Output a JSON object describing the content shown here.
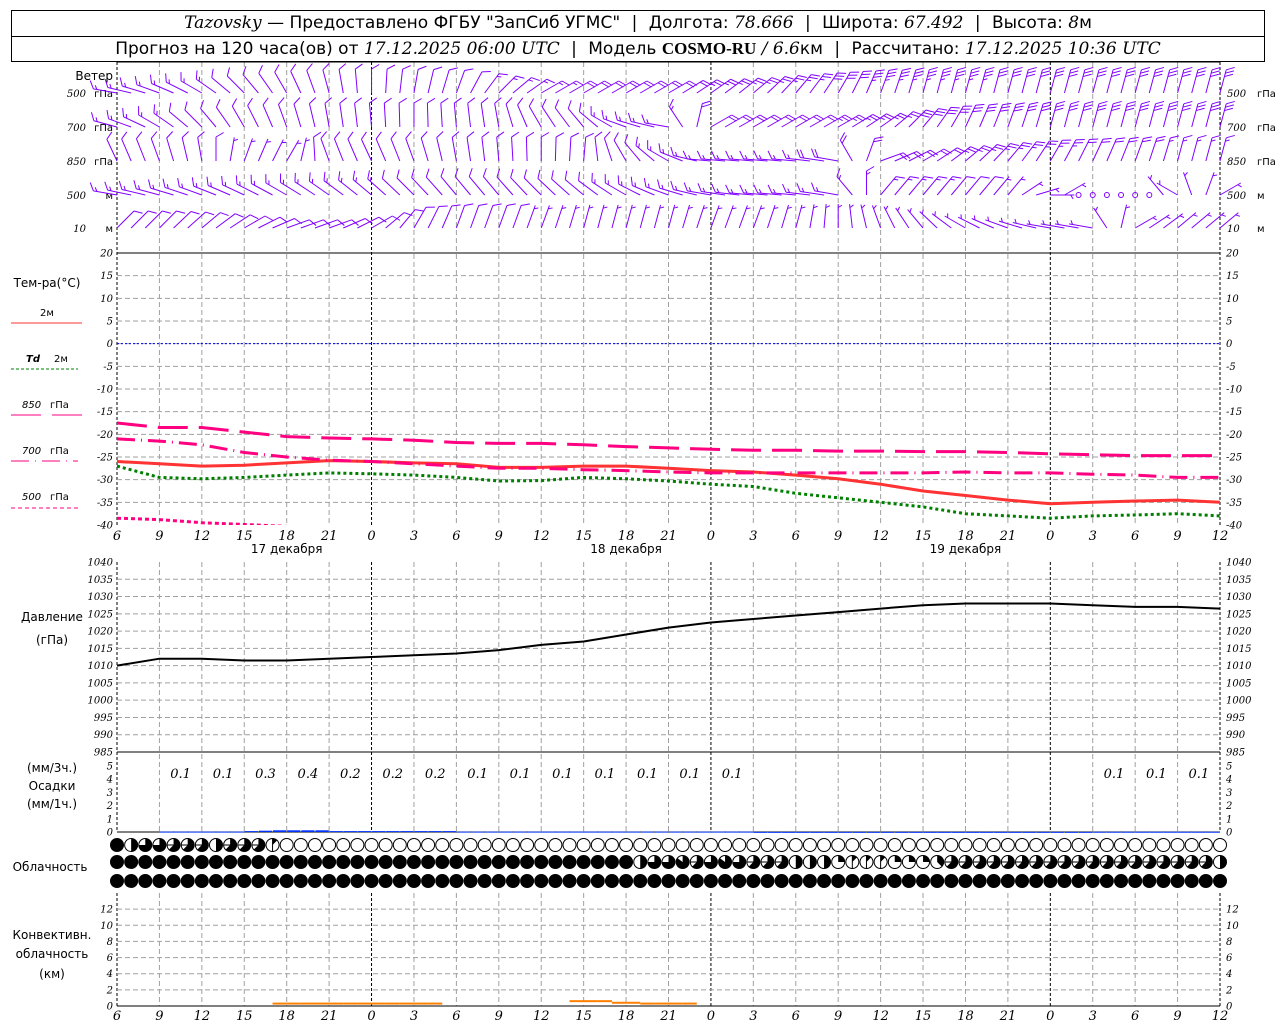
{
  "header": {
    "station": "Tazovsky",
    "provider": "— Предоставлено ФГБУ \"ЗапСиб УГМС\"",
    "lon_label": "Долгота:",
    "lon": "78.666",
    "lat_label": "Широта:",
    "lat": "67.492",
    "alt_label": "Высота:",
    "alt": "8",
    "alt_unit": "м",
    "forecast_label": "Прогноз на 120 часа(ов) от",
    "forecast_start": "17.12.2025 06:00 UTC",
    "model_label": "Модель",
    "model": "COSMO-RU",
    "resolution": "/ 6.6",
    "resolution_unit": "км",
    "computed_label": "Рассчитано:",
    "computed": "17.12.2025 10:36 UTC"
  },
  "colors": {
    "wind": "#8000ff",
    "t2m": "#ff3333",
    "td2m": "#008000",
    "t850": "#ff0080",
    "t700": "#ff0080",
    "t500": "#ff0080",
    "zero_line": "#0000ff",
    "pressure": "#000000",
    "precip": "#0033ff",
    "convective": "#ff8000",
    "grid": "#a0a0a0"
  },
  "labels": {
    "wind": "Ветер",
    "temp": "Тем-ра(°C)",
    "t2m": "2м",
    "td_symbol": "Td",
    "td_level": "2м",
    "l850": "850",
    "l700": "700",
    "l500": "500",
    "gpa": "гПа",
    "pressure": "Давление",
    "pressure_unit": "(гПа)",
    "precip_3h": "(мм/3ч.)",
    "precip": "Осадки",
    "precip_1h": "(мм/1ч.)",
    "clouds": "Облачность",
    "conv1": "Конвективн.",
    "conv2": "облачность",
    "conv3": "(км)"
  },
  "chart_data": {
    "type": "line",
    "time_ticks": [
      "6",
      "9",
      "12",
      "15",
      "18",
      "21",
      "0",
      "3",
      "6",
      "9",
      "12",
      "15",
      "18",
      "21",
      "0",
      "3",
      "6",
      "9",
      "12",
      "15",
      "18",
      "21",
      "0",
      "3",
      "6",
      "9",
      "12"
    ],
    "day_labels": [
      "17 декабря",
      "18 декабря",
      "19 декабря"
    ],
    "wind": {
      "levels": [
        {
          "label": "500",
          "unit": "гПа",
          "dir": [
            280,
            290,
            300,
            315,
            330,
            345,
            0,
            10,
            20,
            45,
            60,
            60,
            60,
            60,
            55,
            50,
            40,
            30,
            20,
            15,
            15,
            15,
            15,
            15,
            15,
            15,
            15
          ],
          "speed_kt": [
            15,
            15,
            15,
            10,
            10,
            10,
            10,
            10,
            10,
            15,
            15,
            20,
            20,
            20,
            25,
            25,
            25,
            30,
            35,
            35,
            35,
            30,
            30,
            30,
            30,
            30,
            30
          ]
        },
        {
          "label": "700",
          "unit": "гПа",
          "dir": [
            285,
            300,
            315,
            330,
            340,
            350,
            355,
            0,
            355,
            350,
            330,
            320,
            290,
            280,
            60,
            60,
            60,
            60,
            55,
            40,
            25,
            20,
            15,
            15,
            15,
            15,
            15
          ],
          "speed_kt": [
            15,
            15,
            10,
            10,
            10,
            10,
            10,
            10,
            10,
            10,
            10,
            10,
            15,
            15,
            20,
            20,
            20,
            25,
            25,
            30,
            30,
            30,
            30,
            30,
            30,
            30,
            30
          ]
        },
        {
          "label": "850",
          "unit": "гПа",
          "dir": [
            335,
            340,
            350,
            20,
            30,
            340,
            335,
            340,
            350,
            355,
            0,
            5,
            330,
            300,
            275,
            275,
            275,
            280,
            70,
            60,
            50,
            40,
            30,
            25,
            20,
            15,
            15
          ],
          "speed_kt": [
            10,
            10,
            10,
            5,
            5,
            10,
            10,
            10,
            10,
            10,
            10,
            10,
            10,
            15,
            15,
            15,
            15,
            20,
            20,
            20,
            25,
            25,
            25,
            20,
            20,
            15,
            15
          ]
        },
        {
          "label": "500",
          "unit": "м",
          "dir": [
            280,
            285,
            290,
            295,
            300,
            305,
            310,
            315,
            320,
            320,
            315,
            310,
            300,
            290,
            280,
            275,
            275,
            280,
            40,
            40,
            40,
            40,
            90,
            0,
            0,
            300,
            60
          ],
          "speed_kt": [
            15,
            15,
            15,
            15,
            15,
            15,
            15,
            10,
            10,
            10,
            10,
            10,
            15,
            15,
            15,
            15,
            15,
            15,
            15,
            15,
            10,
            5,
            5,
            0,
            0,
            5,
            5
          ]
        },
        {
          "label": "10",
          "unit": "м",
          "dir": [
            45,
            45,
            50,
            60,
            70,
            70,
            60,
            30,
            20,
            20,
            20,
            15,
            15,
            15,
            20,
            20,
            15,
            0,
            340,
            320,
            300,
            290,
            280,
            280,
            60,
            50,
            50
          ],
          "speed_kt": [
            10,
            10,
            10,
            10,
            10,
            10,
            10,
            10,
            10,
            10,
            5,
            5,
            5,
            5,
            5,
            5,
            5,
            5,
            5,
            5,
            5,
            5,
            5,
            5,
            5,
            5,
            5
          ]
        }
      ]
    },
    "temperature": {
      "ylim": [
        -40,
        20
      ],
      "yticks": [
        20,
        15,
        10,
        5,
        0,
        -5,
        -10,
        -15,
        -20,
        -25,
        -30,
        -35,
        -40
      ],
      "series": [
        {
          "name": "2м",
          "style": "solid",
          "values": [
            -26,
            -26.5,
            -27,
            -26.8,
            -26.3,
            -25.8,
            -26,
            -26.3,
            -26.5,
            -27.3,
            -27.3,
            -27,
            -27,
            -27.5,
            -28,
            -28.3,
            -29,
            -29.8,
            -31,
            -32.5,
            -33.5,
            -34.5,
            -35.3,
            -35,
            -34.7,
            -34.5,
            -35
          ]
        },
        {
          "name": "Td 2м",
          "style": "dotted",
          "values": [
            -27,
            -29.5,
            -29.8,
            -29.5,
            -29,
            -28.5,
            -28.7,
            -29,
            -29.5,
            -30.3,
            -30.2,
            -29.5,
            -29.8,
            -30.3,
            -31,
            -31.5,
            -33,
            -34,
            -35,
            -36,
            -37.5,
            -38,
            -38.5,
            -38,
            -37.8,
            -37.5,
            -38
          ]
        },
        {
          "name": "850 гПа",
          "style": "dash",
          "values": [
            -17.5,
            -18.5,
            -18.5,
            -19.5,
            -20.5,
            -20.8,
            -21,
            -21.3,
            -21.8,
            -22,
            -22,
            -22.3,
            -22.7,
            -23,
            -23.3,
            -23.5,
            -23.5,
            -23.7,
            -23.7,
            -23.8,
            -23.8,
            -24,
            -24.3,
            -24.5,
            -24.7,
            -24.7,
            -24.7
          ]
        },
        {
          "name": "700 гПа",
          "style": "dashdot",
          "values": [
            -21,
            -21.5,
            -22.3,
            -24,
            -25,
            -25.7,
            -26,
            -26.5,
            -27,
            -27.5,
            -27.5,
            -27.8,
            -28,
            -28.3,
            -28.5,
            -28.5,
            -28.5,
            -28.5,
            -28.5,
            -28.5,
            -28.3,
            -28.5,
            -28.5,
            -28.8,
            -29,
            -29.5,
            -29.5
          ]
        },
        {
          "name": "500 гПа",
          "style": "shortdash",
          "values": [
            -38.5,
            -38.8,
            -39.5,
            -39.9,
            -40.3,
            null,
            null,
            null,
            null,
            null,
            null,
            null,
            null,
            null,
            null,
            null,
            null,
            null,
            null,
            null,
            null,
            null,
            null,
            null,
            null,
            null,
            null
          ]
        }
      ]
    },
    "pressure": {
      "ylim": [
        985,
        1040
      ],
      "yticks": [
        1040,
        1035,
        1030,
        1025,
        1020,
        1015,
        1010,
        1005,
        1000,
        995,
        990,
        985
      ],
      "values": [
        1010,
        1012,
        1012,
        1011.5,
        1011.5,
        1012,
        1012.5,
        1013,
        1013.5,
        1014.5,
        1016,
        1017,
        1019,
        1021,
        1022.5,
        1023.5,
        1024.5,
        1025.5,
        1026.5,
        1027.5,
        1028,
        1028,
        1028,
        1027.5,
        1027,
        1027,
        1026.5
      ]
    },
    "precipitation": {
      "ylim": [
        0,
        5
      ],
      "yticks": [
        5,
        4,
        3,
        2,
        1,
        0
      ],
      "sum_3h": [
        null,
        0.1,
        0.1,
        0.3,
        0.4,
        0.2,
        0.2,
        0.2,
        0.1,
        0.1,
        0.1,
        0.1,
        0.1,
        0.1,
        0.1,
        null,
        null,
        null,
        null,
        null,
        null,
        null,
        null,
        0.1,
        0.1,
        0.1
      ],
      "hourly_mm": [
        0,
        0,
        0,
        0.03,
        0.03,
        0.03,
        0.03,
        0.03,
        0.03,
        0.07,
        0.1,
        0.13,
        0.13,
        0.13,
        0.13,
        0.07,
        0.07,
        0.07,
        0.07,
        0.07,
        0.07,
        0.07,
        0.07,
        0.07,
        0.03,
        0.03,
        0.03,
        0.03,
        0.03,
        0.03,
        0.03,
        0.03,
        0.03,
        0.03,
        0.03,
        0.03,
        0.03,
        0.03,
        0.03,
        0.03,
        0.03,
        0.03,
        0.03,
        0.03,
        0.03,
        0.01,
        0.01,
        0.01,
        0.01,
        0.01,
        0.01,
        0.01,
        0.01,
        0.01,
        0.01,
        0.01,
        0.01,
        0.01,
        0.01,
        0.01,
        0.01,
        0.01,
        0.01,
        0.01,
        0.01,
        0.01,
        0.01,
        0.01,
        0.01,
        0.02,
        0.02,
        0.02,
        0.02,
        0.02,
        0.02,
        0.02,
        0.02,
        0.02
      ]
    },
    "cloudiness_oktas": {
      "top": [
        8,
        4,
        6,
        6,
        5,
        5,
        5,
        4,
        5,
        5,
        5,
        1,
        0,
        0,
        0,
        0,
        0,
        0,
        0,
        0,
        0,
        0,
        0,
        0,
        0,
        0,
        0,
        0,
        0,
        0,
        0,
        0,
        0,
        0,
        0,
        0,
        0,
        0,
        0,
        0,
        0,
        0,
        0,
        0,
        0,
        0,
        0,
        0,
        0,
        0,
        0,
        0,
        0,
        0,
        0,
        0,
        0,
        0,
        0,
        0,
        0,
        0,
        0,
        0,
        0,
        0,
        0,
        0,
        0,
        0,
        0,
        0,
        0,
        0,
        0,
        0,
        0,
        0,
        0
      ],
      "middle": [
        8,
        8,
        8,
        8,
        8,
        8,
        8,
        8,
        8,
        8,
        8,
        8,
        8,
        8,
        8,
        8,
        8,
        8,
        8,
        8,
        8,
        8,
        8,
        8,
        8,
        8,
        8,
        8,
        8,
        8,
        8,
        8,
        8,
        8,
        8,
        8,
        8,
        4,
        6,
        6,
        7,
        5,
        6,
        7,
        6,
        5,
        5,
        5,
        4,
        4,
        4,
        2,
        1,
        1,
        1,
        2,
        2,
        2,
        3,
        5,
        5,
        5,
        5,
        5,
        5,
        5,
        5,
        5,
        5,
        5,
        5,
        5,
        5,
        5,
        5,
        5,
        5,
        5,
        4
      ],
      "bottom": [
        8,
        8,
        8,
        8,
        8,
        8,
        8,
        8,
        8,
        8,
        8,
        8,
        8,
        8,
        8,
        8,
        8,
        8,
        8,
        8,
        8,
        8,
        8,
        8,
        8,
        8,
        8,
        8,
        8,
        8,
        8,
        8,
        8,
        8,
        8,
        8,
        8,
        8,
        8,
        8,
        8,
        8,
        8,
        8,
        8,
        8,
        8,
        8,
        8,
        8,
        8,
        8,
        8,
        8,
        8,
        8,
        8,
        8,
        8,
        8,
        8,
        8,
        8,
        8,
        8,
        8,
        8,
        8,
        8,
        8,
        8,
        8,
        8,
        8,
        8,
        8,
        8,
        8,
        8
      ]
    },
    "convective_cloud_km": {
      "ylim": [
        0,
        14
      ],
      "yticks": [
        12,
        10,
        8,
        6,
        4,
        2,
        0
      ],
      "hourly_top": [
        0,
        0,
        0,
        0,
        0,
        0,
        0,
        0,
        0,
        0,
        0,
        0.3,
        0.3,
        0.3,
        0.3,
        0.3,
        0.3,
        0.3,
        0.3,
        0.3,
        0.3,
        0.3,
        0.3,
        0,
        0,
        0,
        0,
        0,
        0,
        0,
        0,
        0,
        0.6,
        0.6,
        0.6,
        0.4,
        0.4,
        0.3,
        0.3,
        0.3,
        0.3,
        0,
        0,
        0,
        0,
        0,
        0,
        0,
        0,
        0,
        0,
        0,
        0,
        0,
        0,
        0,
        0,
        0,
        0,
        0,
        0,
        0,
        0,
        0,
        0,
        0,
        0,
        0,
        0,
        0,
        0,
        0,
        0,
        0,
        0,
        0,
        0,
        0
      ]
    }
  }
}
